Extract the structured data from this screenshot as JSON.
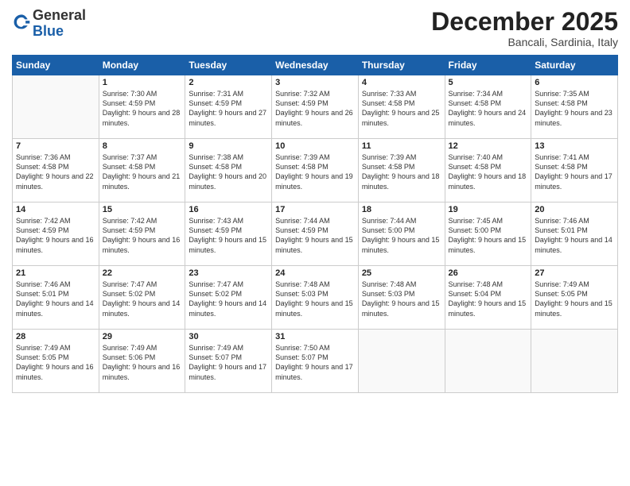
{
  "header": {
    "logo_general": "General",
    "logo_blue": "Blue",
    "month_title": "December 2025",
    "location": "Bancali, Sardinia, Italy"
  },
  "days_of_week": [
    "Sunday",
    "Monday",
    "Tuesday",
    "Wednesday",
    "Thursday",
    "Friday",
    "Saturday"
  ],
  "weeks": [
    [
      {
        "day": "",
        "sunrise": "",
        "sunset": "",
        "daylight": ""
      },
      {
        "day": "1",
        "sunrise": "Sunrise: 7:30 AM",
        "sunset": "Sunset: 4:59 PM",
        "daylight": "Daylight: 9 hours and 28 minutes."
      },
      {
        "day": "2",
        "sunrise": "Sunrise: 7:31 AM",
        "sunset": "Sunset: 4:59 PM",
        "daylight": "Daylight: 9 hours and 27 minutes."
      },
      {
        "day": "3",
        "sunrise": "Sunrise: 7:32 AM",
        "sunset": "Sunset: 4:59 PM",
        "daylight": "Daylight: 9 hours and 26 minutes."
      },
      {
        "day": "4",
        "sunrise": "Sunrise: 7:33 AM",
        "sunset": "Sunset: 4:58 PM",
        "daylight": "Daylight: 9 hours and 25 minutes."
      },
      {
        "day": "5",
        "sunrise": "Sunrise: 7:34 AM",
        "sunset": "Sunset: 4:58 PM",
        "daylight": "Daylight: 9 hours and 24 minutes."
      },
      {
        "day": "6",
        "sunrise": "Sunrise: 7:35 AM",
        "sunset": "Sunset: 4:58 PM",
        "daylight": "Daylight: 9 hours and 23 minutes."
      }
    ],
    [
      {
        "day": "7",
        "sunrise": "Sunrise: 7:36 AM",
        "sunset": "Sunset: 4:58 PM",
        "daylight": "Daylight: 9 hours and 22 minutes."
      },
      {
        "day": "8",
        "sunrise": "Sunrise: 7:37 AM",
        "sunset": "Sunset: 4:58 PM",
        "daylight": "Daylight: 9 hours and 21 minutes."
      },
      {
        "day": "9",
        "sunrise": "Sunrise: 7:38 AM",
        "sunset": "Sunset: 4:58 PM",
        "daylight": "Daylight: 9 hours and 20 minutes."
      },
      {
        "day": "10",
        "sunrise": "Sunrise: 7:39 AM",
        "sunset": "Sunset: 4:58 PM",
        "daylight": "Daylight: 9 hours and 19 minutes."
      },
      {
        "day": "11",
        "sunrise": "Sunrise: 7:39 AM",
        "sunset": "Sunset: 4:58 PM",
        "daylight": "Daylight: 9 hours and 18 minutes."
      },
      {
        "day": "12",
        "sunrise": "Sunrise: 7:40 AM",
        "sunset": "Sunset: 4:58 PM",
        "daylight": "Daylight: 9 hours and 18 minutes."
      },
      {
        "day": "13",
        "sunrise": "Sunrise: 7:41 AM",
        "sunset": "Sunset: 4:58 PM",
        "daylight": "Daylight: 9 hours and 17 minutes."
      }
    ],
    [
      {
        "day": "14",
        "sunrise": "Sunrise: 7:42 AM",
        "sunset": "Sunset: 4:59 PM",
        "daylight": "Daylight: 9 hours and 16 minutes."
      },
      {
        "day": "15",
        "sunrise": "Sunrise: 7:42 AM",
        "sunset": "Sunset: 4:59 PM",
        "daylight": "Daylight: 9 hours and 16 minutes."
      },
      {
        "day": "16",
        "sunrise": "Sunrise: 7:43 AM",
        "sunset": "Sunset: 4:59 PM",
        "daylight": "Daylight: 9 hours and 15 minutes."
      },
      {
        "day": "17",
        "sunrise": "Sunrise: 7:44 AM",
        "sunset": "Sunset: 4:59 PM",
        "daylight": "Daylight: 9 hours and 15 minutes."
      },
      {
        "day": "18",
        "sunrise": "Sunrise: 7:44 AM",
        "sunset": "Sunset: 5:00 PM",
        "daylight": "Daylight: 9 hours and 15 minutes."
      },
      {
        "day": "19",
        "sunrise": "Sunrise: 7:45 AM",
        "sunset": "Sunset: 5:00 PM",
        "daylight": "Daylight: 9 hours and 15 minutes."
      },
      {
        "day": "20",
        "sunrise": "Sunrise: 7:46 AM",
        "sunset": "Sunset: 5:01 PM",
        "daylight": "Daylight: 9 hours and 14 minutes."
      }
    ],
    [
      {
        "day": "21",
        "sunrise": "Sunrise: 7:46 AM",
        "sunset": "Sunset: 5:01 PM",
        "daylight": "Daylight: 9 hours and 14 minutes."
      },
      {
        "day": "22",
        "sunrise": "Sunrise: 7:47 AM",
        "sunset": "Sunset: 5:02 PM",
        "daylight": "Daylight: 9 hours and 14 minutes."
      },
      {
        "day": "23",
        "sunrise": "Sunrise: 7:47 AM",
        "sunset": "Sunset: 5:02 PM",
        "daylight": "Daylight: 9 hours and 14 minutes."
      },
      {
        "day": "24",
        "sunrise": "Sunrise: 7:48 AM",
        "sunset": "Sunset: 5:03 PM",
        "daylight": "Daylight: 9 hours and 15 minutes."
      },
      {
        "day": "25",
        "sunrise": "Sunrise: 7:48 AM",
        "sunset": "Sunset: 5:03 PM",
        "daylight": "Daylight: 9 hours and 15 minutes."
      },
      {
        "day": "26",
        "sunrise": "Sunrise: 7:48 AM",
        "sunset": "Sunset: 5:04 PM",
        "daylight": "Daylight: 9 hours and 15 minutes."
      },
      {
        "day": "27",
        "sunrise": "Sunrise: 7:49 AM",
        "sunset": "Sunset: 5:05 PM",
        "daylight": "Daylight: 9 hours and 15 minutes."
      }
    ],
    [
      {
        "day": "28",
        "sunrise": "Sunrise: 7:49 AM",
        "sunset": "Sunset: 5:05 PM",
        "daylight": "Daylight: 9 hours and 16 minutes."
      },
      {
        "day": "29",
        "sunrise": "Sunrise: 7:49 AM",
        "sunset": "Sunset: 5:06 PM",
        "daylight": "Daylight: 9 hours and 16 minutes."
      },
      {
        "day": "30",
        "sunrise": "Sunrise: 7:49 AM",
        "sunset": "Sunset: 5:07 PM",
        "daylight": "Daylight: 9 hours and 17 minutes."
      },
      {
        "day": "31",
        "sunrise": "Sunrise: 7:50 AM",
        "sunset": "Sunset: 5:07 PM",
        "daylight": "Daylight: 9 hours and 17 minutes."
      },
      {
        "day": "",
        "sunrise": "",
        "sunset": "",
        "daylight": ""
      },
      {
        "day": "",
        "sunrise": "",
        "sunset": "",
        "daylight": ""
      },
      {
        "day": "",
        "sunrise": "",
        "sunset": "",
        "daylight": ""
      }
    ]
  ]
}
